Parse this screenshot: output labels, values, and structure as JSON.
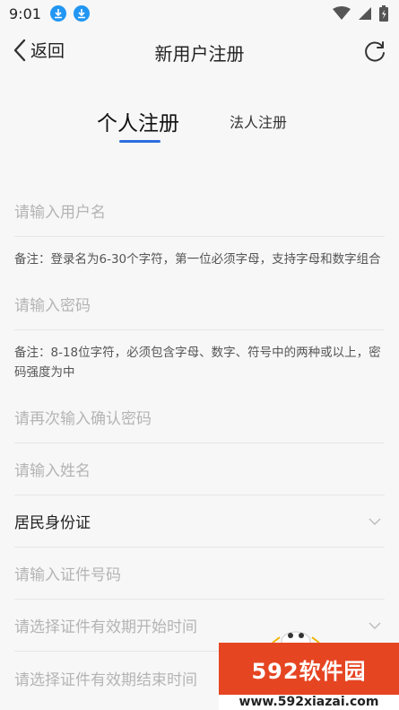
{
  "status_bar": {
    "time": "9:01"
  },
  "header": {
    "back_label": "返回",
    "title": "新用户注册"
  },
  "tabs": {
    "personal": "个人注册",
    "corporate": "法人注册"
  },
  "form": {
    "username_placeholder": "请输入用户名",
    "username_note": "备注：登录名为6-30个字符，第一位必须字母，支持字母和数字组合",
    "password_placeholder": "请输入密码",
    "password_note": "备注：8-18位字符，必须包含字母、数字、符号中的两种或以上，密码强度为中",
    "confirm_password_placeholder": "请再次输入确认密码",
    "name_placeholder": "请输入姓名",
    "id_type_value": "居民身份证",
    "id_number_placeholder": "请输入证件号码",
    "valid_start_placeholder": "请选择证件有效期开始时间",
    "valid_end_placeholder": "请选择证件有效期结束时间"
  },
  "watermark": {
    "brand": "592软件园",
    "url": "www.592xiazai.com"
  },
  "colors": {
    "accent": "#2d6ee0",
    "download_badge": "#2196f3",
    "watermark_bg": "#e64522"
  }
}
